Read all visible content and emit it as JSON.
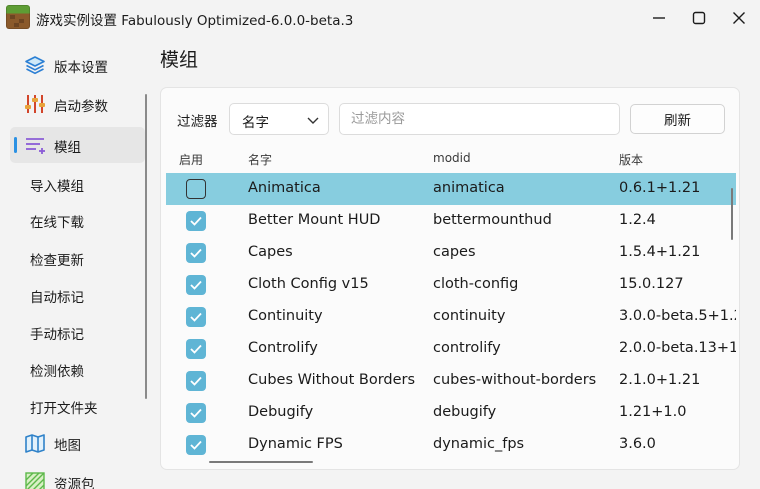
{
  "window": {
    "title": "游戏实例设置 Fabulously Optimized-6.0.0-beta.3"
  },
  "sidebar": {
    "items": [
      {
        "label": "版本设置",
        "icon": "layers-icon"
      },
      {
        "label": "启动参数",
        "icon": "sliders-icon"
      },
      {
        "label": "模组",
        "icon": "list-icon",
        "active": true
      },
      {
        "label": "导入模组"
      },
      {
        "label": "在线下载"
      },
      {
        "label": "检查更新"
      },
      {
        "label": "自动标记"
      },
      {
        "label": "手动标记"
      },
      {
        "label": "检测依赖"
      },
      {
        "label": "打开文件夹"
      },
      {
        "label": "地图",
        "icon": "map-icon"
      },
      {
        "label": "资源包",
        "icon": "texture-icon"
      }
    ]
  },
  "page": {
    "title": "模组"
  },
  "filter": {
    "label": "过滤器",
    "select_value": "名字",
    "search_placeholder": "过滤内容",
    "refresh_label": "刷新"
  },
  "table": {
    "headers": {
      "enabled": "启用",
      "name": "名字",
      "modid": "modid",
      "version": "版本"
    },
    "rows": [
      {
        "enabled": false,
        "selected": true,
        "name": "Animatica",
        "modid": "animatica",
        "version": "0.6.1+1.21"
      },
      {
        "enabled": true,
        "name": "Better Mount HUD",
        "modid": "bettermounthud",
        "version": "1.2.4"
      },
      {
        "enabled": true,
        "name": "Capes",
        "modid": "capes",
        "version": "1.5.4+1.21"
      },
      {
        "enabled": true,
        "name": "Cloth Config v15",
        "modid": "cloth-config",
        "version": "15.0.127"
      },
      {
        "enabled": true,
        "name": "Continuity",
        "modid": "continuity",
        "version": "3.0.0-beta.5+1.21"
      },
      {
        "enabled": true,
        "name": "Controlify",
        "modid": "controlify",
        "version": "2.0.0-beta.13+1.2"
      },
      {
        "enabled": true,
        "name": "Cubes Without Borders",
        "modid": "cubes-without-borders",
        "version": "2.1.0+1.21"
      },
      {
        "enabled": true,
        "name": "Debugify",
        "modid": "debugify",
        "version": "1.21+1.0"
      },
      {
        "enabled": true,
        "name": "Dynamic FPS",
        "modid": "dynamic_fps",
        "version": "3.6.0"
      }
    ]
  },
  "colors": {
    "accent": "#2b91e3",
    "checkbox": "#5fb5d5",
    "selected_row": "#87cddf"
  }
}
